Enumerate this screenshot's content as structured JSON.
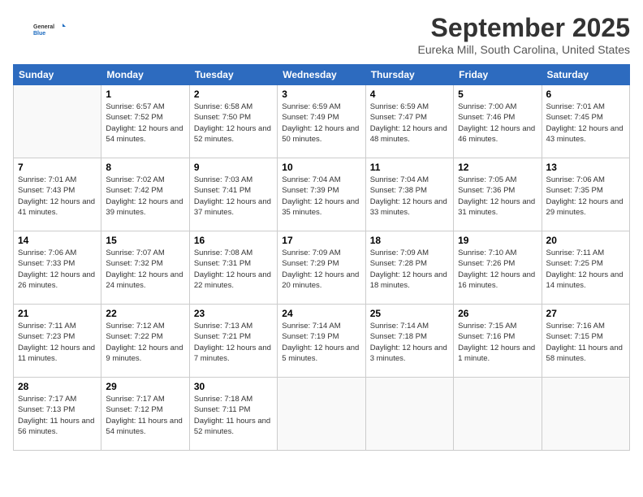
{
  "header": {
    "logo_line1": "General",
    "logo_line2": "Blue",
    "title": "September 2025",
    "subtitle": "Eureka Mill, South Carolina, United States"
  },
  "calendar": {
    "days_of_week": [
      "Sunday",
      "Monday",
      "Tuesday",
      "Wednesday",
      "Thursday",
      "Friday",
      "Saturday"
    ],
    "weeks": [
      [
        {
          "day": "",
          "sunrise": "",
          "sunset": "",
          "daylight": ""
        },
        {
          "day": "1",
          "sunrise": "Sunrise: 6:57 AM",
          "sunset": "Sunset: 7:52 PM",
          "daylight": "Daylight: 12 hours and 54 minutes."
        },
        {
          "day": "2",
          "sunrise": "Sunrise: 6:58 AM",
          "sunset": "Sunset: 7:50 PM",
          "daylight": "Daylight: 12 hours and 52 minutes."
        },
        {
          "day": "3",
          "sunrise": "Sunrise: 6:59 AM",
          "sunset": "Sunset: 7:49 PM",
          "daylight": "Daylight: 12 hours and 50 minutes."
        },
        {
          "day": "4",
          "sunrise": "Sunrise: 6:59 AM",
          "sunset": "Sunset: 7:47 PM",
          "daylight": "Daylight: 12 hours and 48 minutes."
        },
        {
          "day": "5",
          "sunrise": "Sunrise: 7:00 AM",
          "sunset": "Sunset: 7:46 PM",
          "daylight": "Daylight: 12 hours and 46 minutes."
        },
        {
          "day": "6",
          "sunrise": "Sunrise: 7:01 AM",
          "sunset": "Sunset: 7:45 PM",
          "daylight": "Daylight: 12 hours and 43 minutes."
        }
      ],
      [
        {
          "day": "7",
          "sunrise": "Sunrise: 7:01 AM",
          "sunset": "Sunset: 7:43 PM",
          "daylight": "Daylight: 12 hours and 41 minutes."
        },
        {
          "day": "8",
          "sunrise": "Sunrise: 7:02 AM",
          "sunset": "Sunset: 7:42 PM",
          "daylight": "Daylight: 12 hours and 39 minutes."
        },
        {
          "day": "9",
          "sunrise": "Sunrise: 7:03 AM",
          "sunset": "Sunset: 7:41 PM",
          "daylight": "Daylight: 12 hours and 37 minutes."
        },
        {
          "day": "10",
          "sunrise": "Sunrise: 7:04 AM",
          "sunset": "Sunset: 7:39 PM",
          "daylight": "Daylight: 12 hours and 35 minutes."
        },
        {
          "day": "11",
          "sunrise": "Sunrise: 7:04 AM",
          "sunset": "Sunset: 7:38 PM",
          "daylight": "Daylight: 12 hours and 33 minutes."
        },
        {
          "day": "12",
          "sunrise": "Sunrise: 7:05 AM",
          "sunset": "Sunset: 7:36 PM",
          "daylight": "Daylight: 12 hours and 31 minutes."
        },
        {
          "day": "13",
          "sunrise": "Sunrise: 7:06 AM",
          "sunset": "Sunset: 7:35 PM",
          "daylight": "Daylight: 12 hours and 29 minutes."
        }
      ],
      [
        {
          "day": "14",
          "sunrise": "Sunrise: 7:06 AM",
          "sunset": "Sunset: 7:33 PM",
          "daylight": "Daylight: 12 hours and 26 minutes."
        },
        {
          "day": "15",
          "sunrise": "Sunrise: 7:07 AM",
          "sunset": "Sunset: 7:32 PM",
          "daylight": "Daylight: 12 hours and 24 minutes."
        },
        {
          "day": "16",
          "sunrise": "Sunrise: 7:08 AM",
          "sunset": "Sunset: 7:31 PM",
          "daylight": "Daylight: 12 hours and 22 minutes."
        },
        {
          "day": "17",
          "sunrise": "Sunrise: 7:09 AM",
          "sunset": "Sunset: 7:29 PM",
          "daylight": "Daylight: 12 hours and 20 minutes."
        },
        {
          "day": "18",
          "sunrise": "Sunrise: 7:09 AM",
          "sunset": "Sunset: 7:28 PM",
          "daylight": "Daylight: 12 hours and 18 minutes."
        },
        {
          "day": "19",
          "sunrise": "Sunrise: 7:10 AM",
          "sunset": "Sunset: 7:26 PM",
          "daylight": "Daylight: 12 hours and 16 minutes."
        },
        {
          "day": "20",
          "sunrise": "Sunrise: 7:11 AM",
          "sunset": "Sunset: 7:25 PM",
          "daylight": "Daylight: 12 hours and 14 minutes."
        }
      ],
      [
        {
          "day": "21",
          "sunrise": "Sunrise: 7:11 AM",
          "sunset": "Sunset: 7:23 PM",
          "daylight": "Daylight: 12 hours and 11 minutes."
        },
        {
          "day": "22",
          "sunrise": "Sunrise: 7:12 AM",
          "sunset": "Sunset: 7:22 PM",
          "daylight": "Daylight: 12 hours and 9 minutes."
        },
        {
          "day": "23",
          "sunrise": "Sunrise: 7:13 AM",
          "sunset": "Sunset: 7:21 PM",
          "daylight": "Daylight: 12 hours and 7 minutes."
        },
        {
          "day": "24",
          "sunrise": "Sunrise: 7:14 AM",
          "sunset": "Sunset: 7:19 PM",
          "daylight": "Daylight: 12 hours and 5 minutes."
        },
        {
          "day": "25",
          "sunrise": "Sunrise: 7:14 AM",
          "sunset": "Sunset: 7:18 PM",
          "daylight": "Daylight: 12 hours and 3 minutes."
        },
        {
          "day": "26",
          "sunrise": "Sunrise: 7:15 AM",
          "sunset": "Sunset: 7:16 PM",
          "daylight": "Daylight: 12 hours and 1 minute."
        },
        {
          "day": "27",
          "sunrise": "Sunrise: 7:16 AM",
          "sunset": "Sunset: 7:15 PM",
          "daylight": "Daylight: 11 hours and 58 minutes."
        }
      ],
      [
        {
          "day": "28",
          "sunrise": "Sunrise: 7:17 AM",
          "sunset": "Sunset: 7:13 PM",
          "daylight": "Daylight: 11 hours and 56 minutes."
        },
        {
          "day": "29",
          "sunrise": "Sunrise: 7:17 AM",
          "sunset": "Sunset: 7:12 PM",
          "daylight": "Daylight: 11 hours and 54 minutes."
        },
        {
          "day": "30",
          "sunrise": "Sunrise: 7:18 AM",
          "sunset": "Sunset: 7:11 PM",
          "daylight": "Daylight: 11 hours and 52 minutes."
        },
        {
          "day": "",
          "sunrise": "",
          "sunset": "",
          "daylight": ""
        },
        {
          "day": "",
          "sunrise": "",
          "sunset": "",
          "daylight": ""
        },
        {
          "day": "",
          "sunrise": "",
          "sunset": "",
          "daylight": ""
        },
        {
          "day": "",
          "sunrise": "",
          "sunset": "",
          "daylight": ""
        }
      ]
    ]
  }
}
